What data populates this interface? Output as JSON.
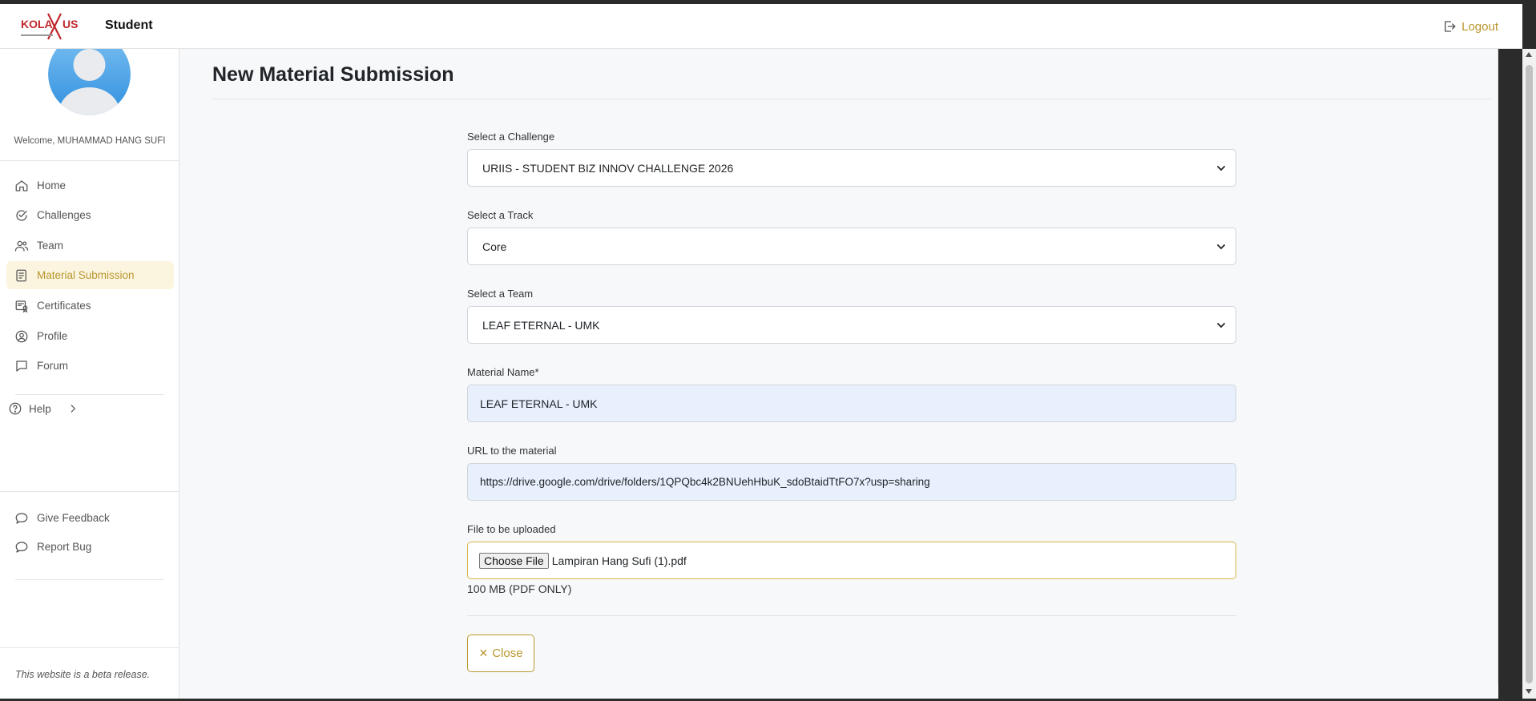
{
  "header": {
    "logo_text": "KOLAXUS",
    "brand": "Student",
    "logout_label": "Logout"
  },
  "sidebar": {
    "welcome": "Welcome, MUHAMMAD HANG SUFI",
    "items": [
      {
        "label": "Home",
        "icon": "home-icon"
      },
      {
        "label": "Challenges",
        "icon": "check-circle-icon"
      },
      {
        "label": "Team",
        "icon": "users-icon"
      },
      {
        "label": "Material Submission",
        "icon": "document-icon",
        "active": true
      },
      {
        "label": "Certificates",
        "icon": "certificate-icon"
      },
      {
        "label": "Profile",
        "icon": "user-circle-icon"
      },
      {
        "label": "Forum",
        "icon": "chat-icon"
      }
    ],
    "help_label": "Help",
    "feedback_label": "Give Feedback",
    "report_label": "Report Bug",
    "beta_note": "This website is a beta release."
  },
  "page": {
    "title": "New Material Submission"
  },
  "form": {
    "challenge_label": "Select a Challenge",
    "challenge_value": "URIIS - STUDENT BIZ INNOV CHALLENGE 2026",
    "track_label": "Select a Track",
    "track_value": "Core",
    "team_label": "Select a Team",
    "team_value": "LEAF ETERNAL - UMK",
    "material_name_label": "Material Name*",
    "material_name_value": "LEAF ETERNAL - UMK",
    "url_label": "URL to the material",
    "url_value": "https://drive.google.com/drive/folders/1QPQbc4k2BNUehHbuK_sdoBtaidTtFO7x?usp=sharing",
    "file_label": "File to be uploaded",
    "choose_file_label": "Choose File",
    "file_name": "Lampiran Hang Sufi (1).pdf",
    "file_hint": "100 MB (PDF ONLY)",
    "close_label": "Close"
  },
  "colors": {
    "accent": "#b8962e",
    "active_bg": "#fbf5e0",
    "filled_input_bg": "#e8f0fe"
  }
}
